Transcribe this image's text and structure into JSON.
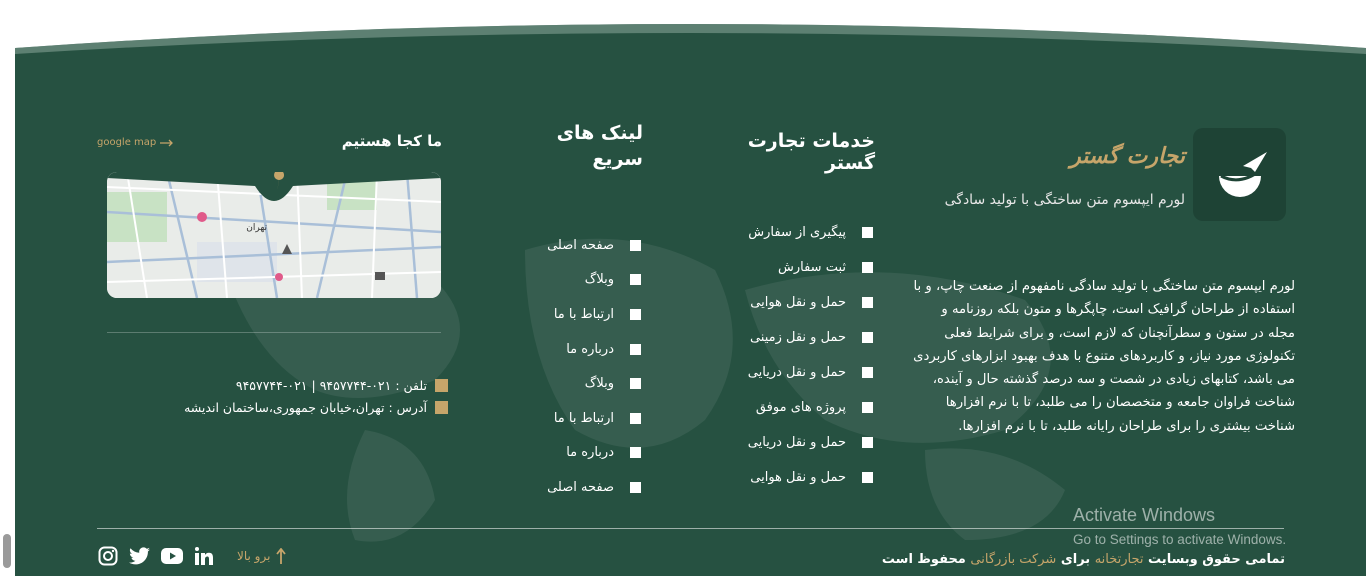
{
  "colors": {
    "background": "#265141",
    "accent": "#c6a56a",
    "text": "#ffffff"
  },
  "brand": {
    "name": "تجارت گستر",
    "tagline": "لورم ایپسوم متن ساختگی با تولید سادگی",
    "about": "لورم ایپسوم متن ساختگی با تولید سادگی نامفهوم از صنعت چاپ، و با استفاده از طراحان گرافیک است، چاپگرها و متون بلکه روزنامه و مجله در ستون و سطرآنچنان که لازم است، و برای شرایط فعلی تکنولوژی مورد نیاز، و کاربردهای متنوع با هدف بهبود ابزارهای کاربردی می باشد، کتابهای زیادی در شصت و سه درصد گذشته حال و آینده، شناخت فراوان جامعه و متخصصان را می طلبد، تا با نرم افزارها شناخت بیشتری را برای طراحان رایانه طلبد، تا با نرم افزارها."
  },
  "services": {
    "heading": "خدمات تجارت گستر",
    "items": [
      "پیگیری از سفارش",
      "ثبت سفارش",
      "حمل و نقل هوایی",
      "حمل و نقل زمینی",
      "حمل و نقل دریایی",
      "پروژه های موفق",
      "حمل و نقل دریایی",
      "حمل و نقل هوایی"
    ]
  },
  "quick_links": {
    "heading": "لینک های سریع",
    "items": [
      "صفحه اصلی",
      "وبلاگ",
      "ارتباط با ما",
      "درباره ما",
      "وبلاگ",
      "ارتباط با ما",
      "درباره ما",
      "صفحه اصلی"
    ]
  },
  "location": {
    "heading": "ما کجا هستیم",
    "map_link": "google map",
    "map_city_label": "تهران"
  },
  "contact": {
    "phone": "تلفن : ۰۲۱-۹۴۵۷۷۴۴ | ۰۲۱-۹۴۵۷۷۴۴",
    "address": "آدرس : تهران،خیابان جمهوری،ساختمان اندیشه"
  },
  "copyright": {
    "part1": "تمامی حقوق وبسایت",
    "site": "تجارتخانه",
    "part2": "برای",
    "company": "شرکت بازرگانی",
    "part3": "محفوظ است"
  },
  "scroll_top": {
    "label": "برو بالا"
  },
  "socials": [
    "instagram-icon",
    "twitter-icon",
    "youtube-icon",
    "linkedin-icon"
  ],
  "os_watermark": {
    "title": "Activate Windows",
    "subtitle": "Go to Settings to activate Windows."
  }
}
